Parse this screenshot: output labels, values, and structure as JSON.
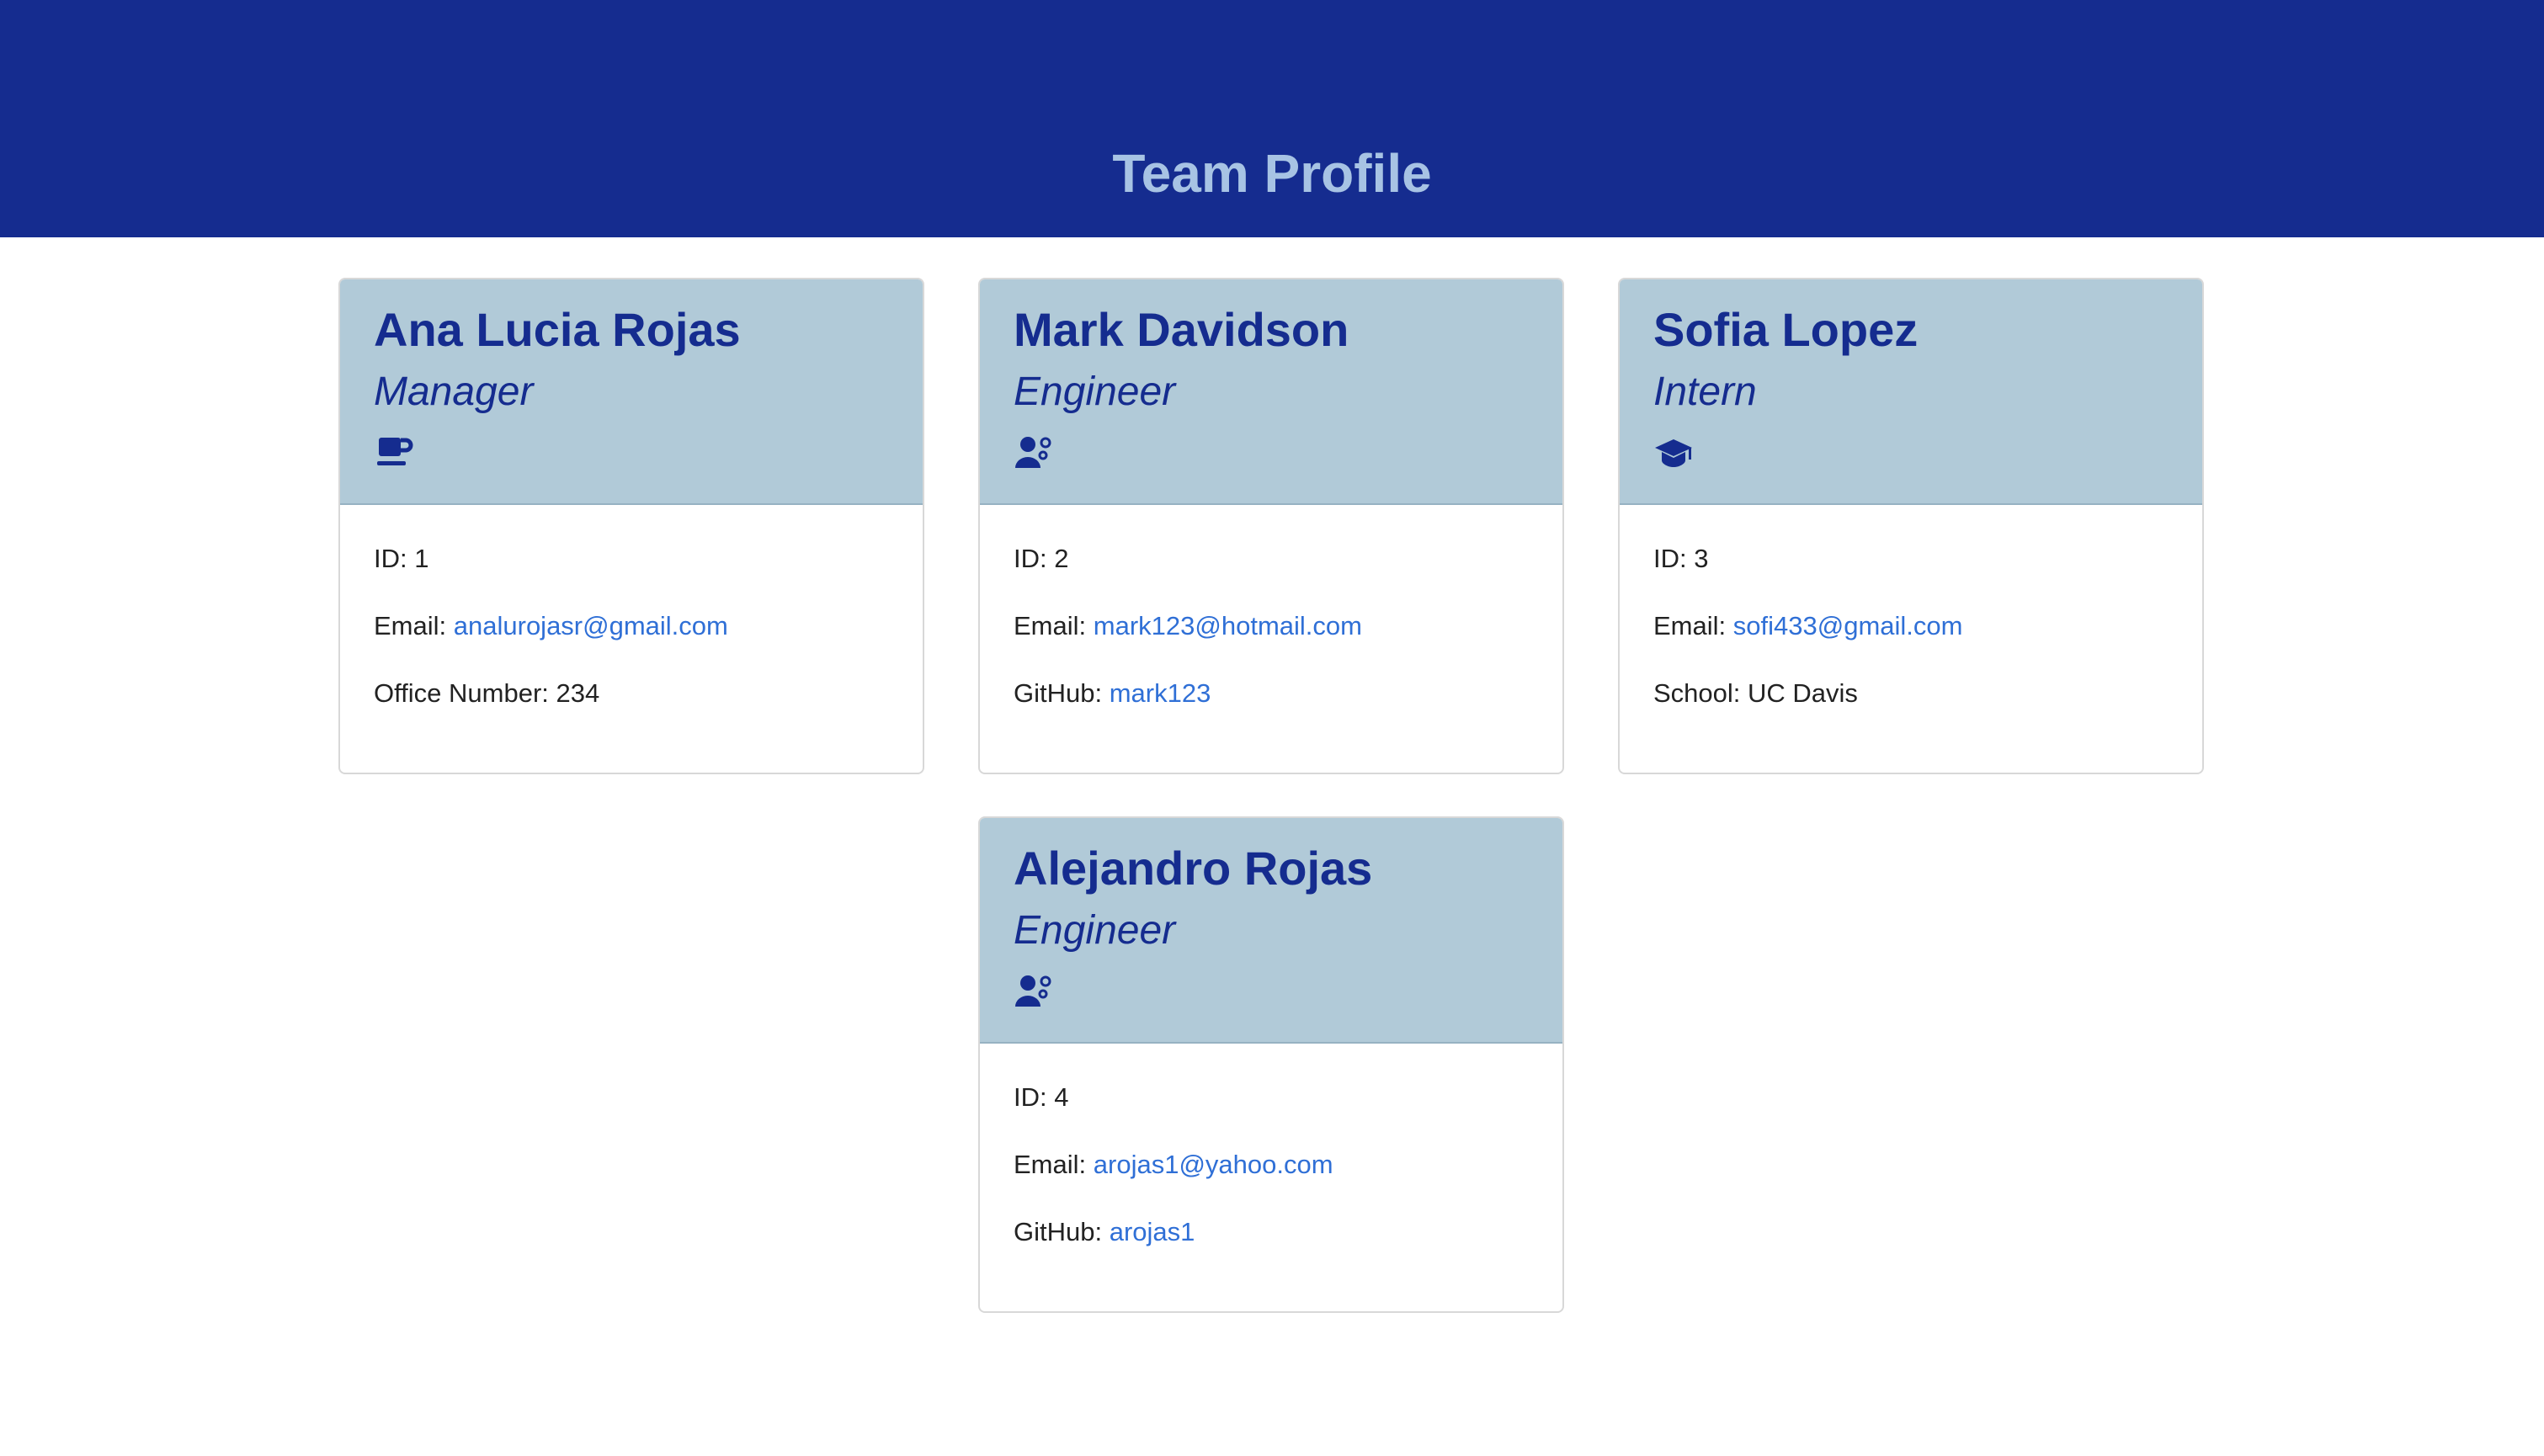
{
  "page": {
    "title": "Team Profile"
  },
  "colors": {
    "header_bg": "#152c8f",
    "header_title": "#a7c3e4",
    "card_head_bg": "#b1cad8",
    "card_text": "#152c8f",
    "link": "#2f6fd6"
  },
  "cards": [
    {
      "name": "Ana Lucia Rojas",
      "role": "Manager",
      "icon": "coffee-mug-icon",
      "id_label": "ID:",
      "id": "1",
      "email_label": "Email:",
      "email": "analurojasr@gmail.com",
      "extra_label": "Office Number:",
      "extra_value": "234"
    },
    {
      "name": "Mark Davidson",
      "role": "Engineer",
      "icon": "user-gears-icon",
      "id_label": "ID:",
      "id": "2",
      "email_label": "Email:",
      "email": "mark123@hotmail.com",
      "extra_label": "GitHub:",
      "extra_value": "mark123"
    },
    {
      "name": "Sofia Lopez",
      "role": "Intern",
      "icon": "graduation-cap-icon",
      "id_label": "ID:",
      "id": "3",
      "email_label": "Email:",
      "email": "sofi433@gmail.com",
      "extra_label": "School:",
      "extra_value": "UC Davis"
    },
    {
      "name": "Alejandro Rojas",
      "role": "Engineer",
      "icon": "user-gears-icon",
      "id_label": "ID:",
      "id": "4",
      "email_label": "Email:",
      "email": "arojas1@yahoo.com",
      "extra_label": "GitHub:",
      "extra_value": "arojas1"
    }
  ]
}
